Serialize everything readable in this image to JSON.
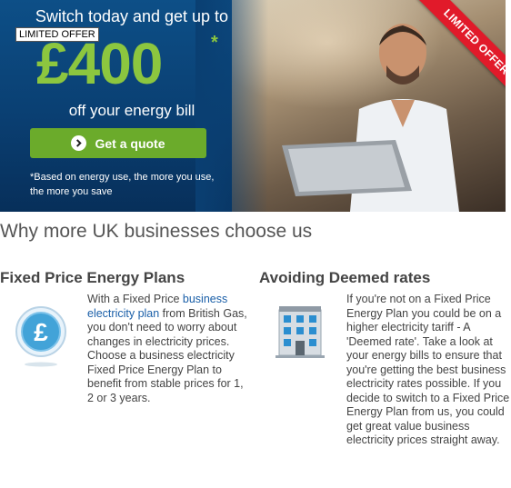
{
  "hero": {
    "headline": "Switch today and get up to",
    "amount": "£400",
    "amount_asterisk": "*",
    "subline": "off your energy bill",
    "cta_label": "Get a quote",
    "footnote_line1": "*Based on energy use, the more you use,",
    "footnote_line2": "the more you save",
    "ribbon": "LIMITED OFFER",
    "tooltip": "LIMITED OFFER"
  },
  "section": {
    "title": "Why more UK businesses choose us"
  },
  "columns": [
    {
      "heading": "Fixed Price Energy Plans",
      "text_before": "With a Fixed Price ",
      "link": "business electricity plan",
      "text_after": " from British Gas, you don't need to worry about changes in electricity prices. Choose a business electricity Fixed Price Energy Plan to benefit from stable prices for 1, 2 or 3 years."
    },
    {
      "heading": "Avoiding Deemed rates",
      "text": "If you're not on a Fixed Price Energy Plan you could be on a higher electricity tariff - A 'Deemed rate'. Take a look at your energy bills to ensure that you're getting the best business electricity rates possible. If you decide to switch to a Fixed Price Energy Plan from us, you could get great value business electricity prices straight away."
    }
  ],
  "colors": {
    "hero_blue": "#0a3f72",
    "accent_green": "#8cc63f",
    "button_green": "#6bab2b",
    "ribbon_red": "#e11a2a",
    "link_blue": "#1a5fa8"
  },
  "icons": [
    "chevron-right-icon",
    "pound-coin-icon",
    "office-building-icon"
  ]
}
